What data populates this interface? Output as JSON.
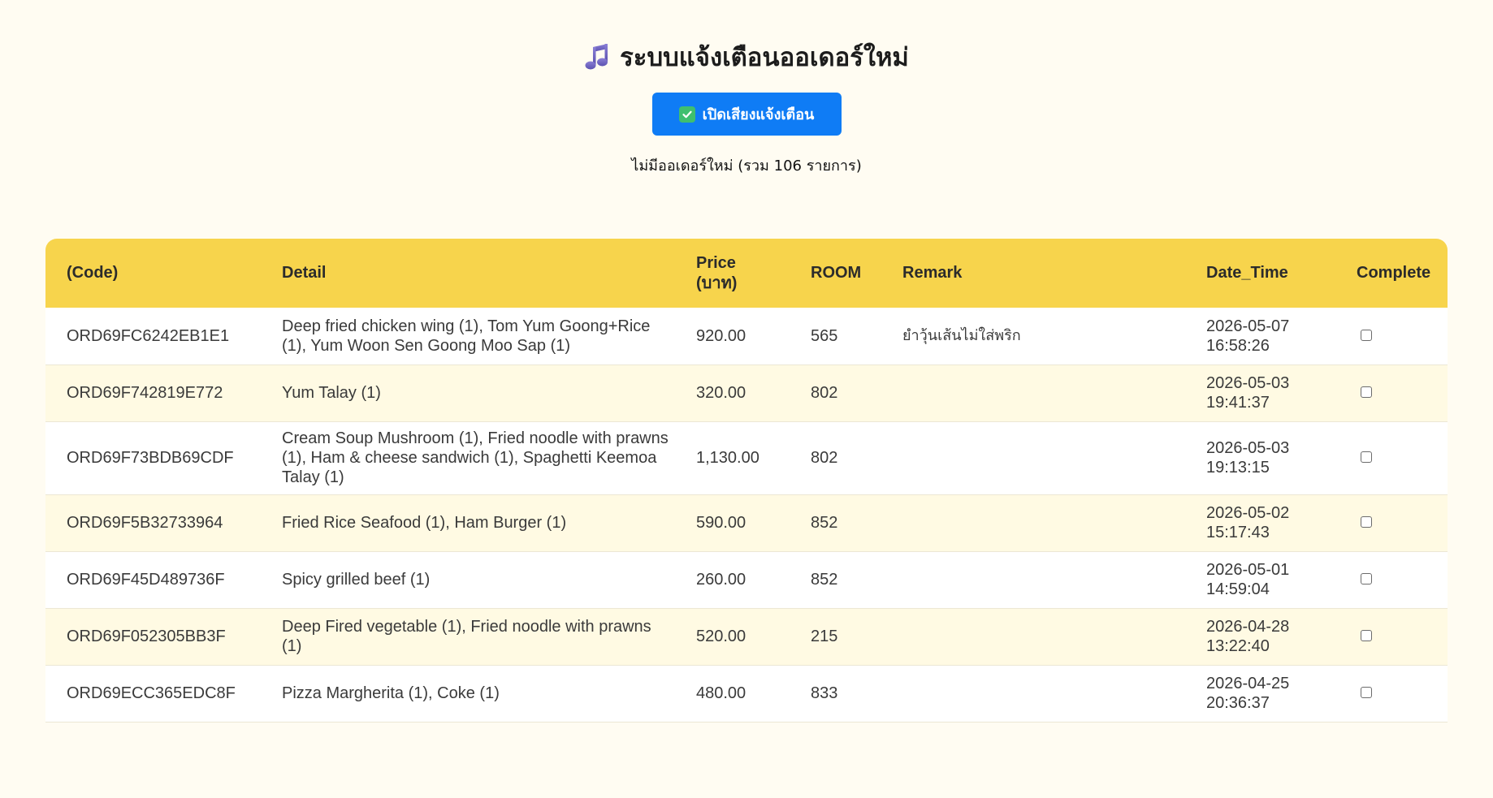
{
  "header": {
    "title": "ระบบแจ้งเตือนออเดอร์ใหม่",
    "title_icon": "music-note-icon",
    "sound_button_label": "เปิดเสียงแจ้งเตือน",
    "sound_button_icon": "check-box-icon",
    "status_text": "ไม่มีออเดอร์ใหม่ (รวม 106 รายการ)"
  },
  "colors": {
    "accent": "#0f7cf5",
    "table_header": "#f7d44c",
    "row_alt": "#fffae3",
    "background": "#fffcf2"
  },
  "table": {
    "columns": {
      "code": "(Code)",
      "detail": "Detail",
      "price_line1": "Price",
      "price_line2": "(บาท)",
      "room": "ROOM",
      "remark": "Remark",
      "date_time": "Date_Time",
      "complete": "Complete"
    },
    "rows": [
      {
        "code": "ORD69FC6242EB1E1",
        "detail": "Deep fried chicken wing (1), Tom Yum Goong+Rice (1), Yum Woon Sen Goong Moo Sap (1)",
        "price": "920.00",
        "room": "565",
        "remark": "ยำวุ้นเส้นไม่ใส่พริก",
        "date": "2026-05-07",
        "time": "16:58:26"
      },
      {
        "code": "ORD69F742819E772",
        "detail": "Yum Talay (1)",
        "price": "320.00",
        "room": "802",
        "remark": "",
        "date": "2026-05-03",
        "time": "19:41:37"
      },
      {
        "code": "ORD69F73BDB69CDF",
        "detail": "Cream Soup Mushroom (1), Fried noodle with prawns (1), Ham & cheese sandwich (1), Spaghetti Keemoa Talay (1)",
        "price": "1,130.00",
        "room": "802",
        "remark": "",
        "date": "2026-05-03",
        "time": "19:13:15"
      },
      {
        "code": "ORD69F5B32733964",
        "detail": "Fried Rice Seafood (1), Ham Burger (1)",
        "price": "590.00",
        "room": "852",
        "remark": "",
        "date": "2026-05-02",
        "time": "15:17:43"
      },
      {
        "code": "ORD69F45D489736F",
        "detail": "Spicy grilled beef (1)",
        "price": "260.00",
        "room": "852",
        "remark": "",
        "date": "2026-05-01",
        "time": "14:59:04"
      },
      {
        "code": "ORD69F052305BB3F",
        "detail": "Deep Fired vegetable (1), Fried noodle with prawns (1)",
        "price": "520.00",
        "room": "215",
        "remark": "",
        "date": "2026-04-28",
        "time": "13:22:40"
      },
      {
        "code": "ORD69ECC365EDC8F",
        "detail": "Pizza Margherita (1), Coke (1)",
        "price": "480.00",
        "room": "833",
        "remark": "",
        "date": "2026-04-25",
        "time": "20:36:37"
      }
    ]
  }
}
